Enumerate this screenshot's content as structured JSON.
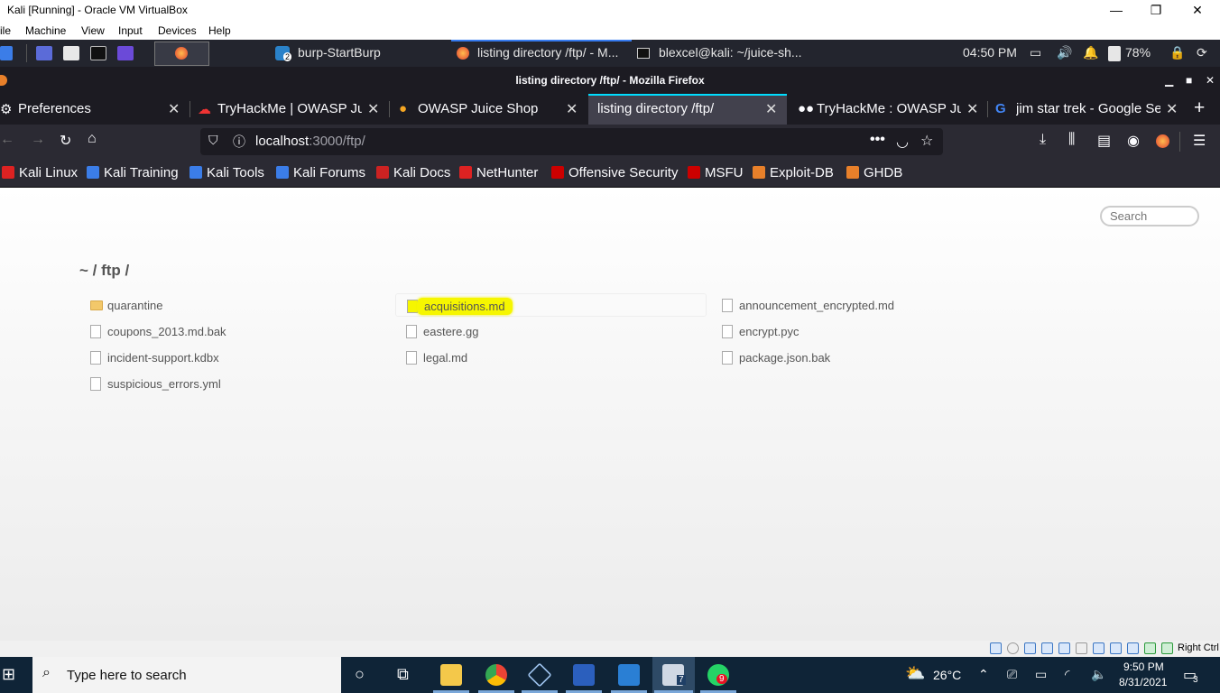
{
  "vbox": {
    "title": "Kali [Running] - Oracle VM VirtualBox",
    "minimize": "—",
    "maximize": "❐",
    "close": "✕",
    "menu": [
      "ile",
      "Machine",
      "View",
      "Input",
      "Devices",
      "Help"
    ]
  },
  "kali_panel": {
    "tasks": [
      {
        "label": "burp-StartBurp",
        "badge": "2"
      },
      {
        "label": "listing directory /ftp/ - M..."
      },
      {
        "label": "blexcel@kali: ~/juice-sh..."
      }
    ],
    "clock": "04:50 PM",
    "battery": "78%"
  },
  "firefox": {
    "window_title": "listing directory /ftp/ - Mozilla Firefox",
    "tabs": [
      {
        "label": "Preferences"
      },
      {
        "label": "TryHackMe | OWASP Jui"
      },
      {
        "label": "OWASP Juice Shop"
      },
      {
        "label": "listing directory /ftp/"
      },
      {
        "label": "TryHackMe : OWASP Jui"
      },
      {
        "label": "jim star trek - Google Se"
      }
    ],
    "url_host": "localhost",
    "url_rest": ":3000/ftp/",
    "bookmarks": [
      {
        "label": "Kali Linux",
        "color": "#d22"
      },
      {
        "label": "Kali Training",
        "color": "#3b7de8"
      },
      {
        "label": "Kali Tools",
        "color": "#3b7de8"
      },
      {
        "label": "Kali Forums",
        "color": "#3b7de8"
      },
      {
        "label": "Kali Docs",
        "color": "#c22"
      },
      {
        "label": "NetHunter",
        "color": "#d22"
      },
      {
        "label": "Offensive Security",
        "color": "#c00"
      },
      {
        "label": "MSFU",
        "color": "#c00"
      },
      {
        "label": "Exploit-DB",
        "color": "#e8802a"
      },
      {
        "label": "GHDB",
        "color": "#e8802a"
      }
    ]
  },
  "page": {
    "search_placeholder": "Search",
    "breadcrumb": "~ / ftp /",
    "files": [
      {
        "name": "quarantine",
        "type": "folder"
      },
      {
        "name": "acquisitions.md",
        "type": "file",
        "highlighted": true
      },
      {
        "name": "announcement_encrypted.md",
        "type": "file"
      },
      {
        "name": "coupons_2013.md.bak",
        "type": "file"
      },
      {
        "name": "eastere.gg",
        "type": "file"
      },
      {
        "name": "encrypt.pyc",
        "type": "file"
      },
      {
        "name": "incident-support.kdbx",
        "type": "file"
      },
      {
        "name": "legal.md",
        "type": "file"
      },
      {
        "name": "package.json.bak",
        "type": "file"
      },
      {
        "name": "suspicious_errors.yml",
        "type": "file"
      }
    ]
  },
  "vbox_status": {
    "host_key": "Right Ctrl"
  },
  "windows": {
    "search_placeholder": "Type here to search",
    "whatsapp_badge": "9",
    "vbox_badge": "7",
    "weather": "26°C",
    "time": "9:50 PM",
    "date": "8/31/2021",
    "notifications": "3"
  }
}
